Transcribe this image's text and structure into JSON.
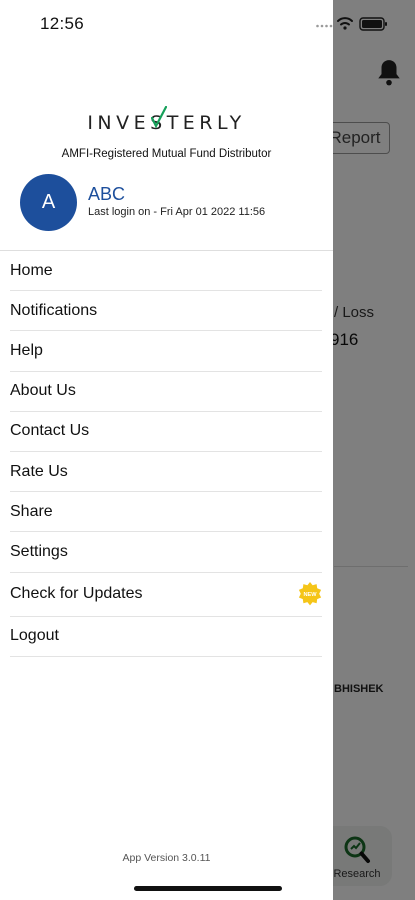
{
  "status_bar": {
    "time": "12:56"
  },
  "background": {
    "report_button": "Report",
    "pl_label": "/ Loss",
    "pl_value": "916",
    "name_fragment": "BHISHEK",
    "research_label": "Research"
  },
  "drawer": {
    "logo": "INVESTERLY",
    "tagline": "AMFI-Registered Mutual Fund Distributor",
    "avatar_initial": "A",
    "user_name": "ABC",
    "last_login": "Last login on - Fri Apr 01 2022 11:56",
    "menu": [
      {
        "label": "Home"
      },
      {
        "label": "Notifications"
      },
      {
        "label": "Help"
      },
      {
        "label": "About Us"
      },
      {
        "label": "Contact Us"
      },
      {
        "label": "Rate Us"
      },
      {
        "label": "Share"
      },
      {
        "label": "Settings"
      },
      {
        "label": "Check for Updates",
        "badge": "NEW"
      },
      {
        "label": "Logout"
      }
    ],
    "app_version": "App Version 3.0.11"
  },
  "colors": {
    "brand_blue": "#1d4f9c",
    "logo_check_green": "#16a05a",
    "badge_yellow": "#f5c518"
  }
}
